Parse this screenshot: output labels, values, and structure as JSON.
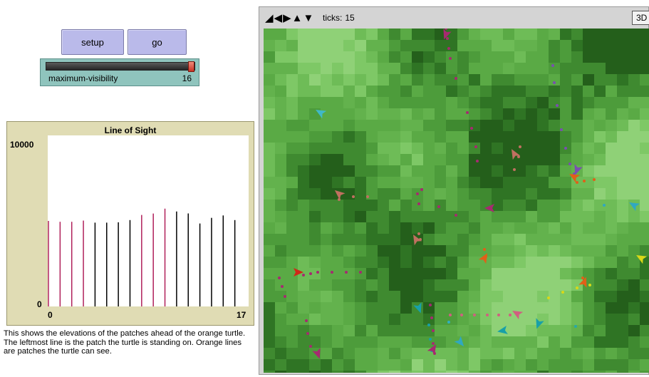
{
  "controls": {
    "setup_label": "setup",
    "go_label": "go"
  },
  "slider": {
    "label": "maximum-visibility",
    "value": "16",
    "value_num": 16,
    "min": 0,
    "max": 16
  },
  "chart_data": {
    "type": "bar",
    "title": "Line of Sight",
    "ylim": [
      0,
      10000
    ],
    "ytick_labels": [
      "10000",
      "0"
    ],
    "xtick_labels": [
      "0",
      "17"
    ],
    "xlim": [
      0,
      17
    ],
    "x": [
      0,
      1,
      2,
      3,
      4,
      5,
      6,
      7,
      8,
      9,
      10,
      11,
      12,
      13,
      14,
      15,
      16
    ],
    "values": [
      5000,
      4950,
      4950,
      5020,
      4900,
      4900,
      4920,
      5050,
      5350,
      5430,
      5720,
      5550,
      5440,
      4850,
      5180,
      5320,
      5050
    ],
    "visible": [
      1,
      1,
      1,
      1,
      0,
      0,
      0,
      0,
      1,
      1,
      1,
      0,
      0,
      0,
      0,
      0,
      0
    ],
    "colors": {
      "visible": "#b0205a",
      "hidden": "#000000"
    }
  },
  "caption": {
    "text": "This shows the elevations of the patches ahead of the orange turtle. The leftmost line is the patch the turtle is standing on. Orange lines are patches the turtle can see."
  },
  "view": {
    "ticks_label": "ticks:",
    "ticks_value": "15",
    "three_d_label": "3D",
    "icons": [
      "resize-icon",
      "horizontal-arrows-icon",
      "vertical-arrows-icon"
    ],
    "terrain_colors": [
      "#4d9c3b",
      "#5aaa45",
      "#63b24d",
      "#6ebc57",
      "#7ec866",
      "#8fd177",
      "#3f8a30",
      "#2f7424",
      "#245f1b"
    ]
  }
}
